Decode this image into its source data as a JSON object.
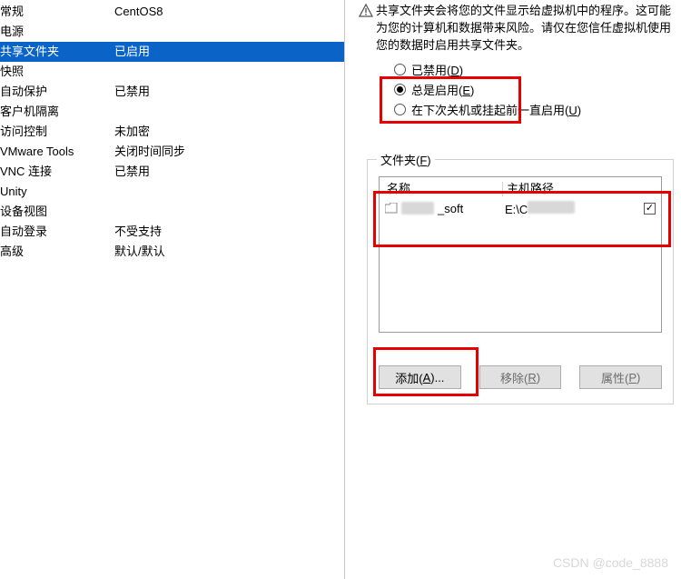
{
  "nav": {
    "items": [
      {
        "label": "常规",
        "value": "CentOS8",
        "selected": false
      },
      {
        "label": "电源",
        "value": "",
        "selected": false
      },
      {
        "label": "共享文件夹",
        "value": "已启用",
        "selected": true
      },
      {
        "label": "快照",
        "value": "",
        "selected": false
      },
      {
        "label": "自动保护",
        "value": "已禁用",
        "selected": false
      },
      {
        "label": "客户机隔离",
        "value": "",
        "selected": false
      },
      {
        "label": "访问控制",
        "value": "未加密",
        "selected": false
      },
      {
        "label": "VMware Tools",
        "value": "关闭时间同步",
        "selected": false
      },
      {
        "label": "VNC 连接",
        "value": "已禁用",
        "selected": false
      },
      {
        "label": "Unity",
        "value": "",
        "selected": false
      },
      {
        "label": "设备视图",
        "value": "",
        "selected": false
      },
      {
        "label": "自动登录",
        "value": "不受支持",
        "selected": false
      },
      {
        "label": "高级",
        "value": "默认/默认",
        "selected": false
      }
    ]
  },
  "info": {
    "text": "共享文件夹会将您的文件显示给虚拟机中的程序。这可能为您的计算机和数据带来风险。请仅在您信任虚拟机使用您的数据时启用共享文件夹。"
  },
  "radios": {
    "disabled": {
      "text": "已禁用(",
      "hot": "D",
      "tail": ")"
    },
    "always": {
      "text": "总是启用(",
      "hot": "E",
      "tail": ")"
    },
    "until": {
      "text": "在下次关机或挂起前一直启用(",
      "hot": "U",
      "tail": ")"
    }
  },
  "folders": {
    "legend": {
      "text": "文件夹(",
      "hot": "F",
      "tail": ")"
    },
    "columns": {
      "name": "名称",
      "path": "主机路径"
    },
    "row": {
      "name_prefix": "",
      "name_suffix": "_soft",
      "path_prefix": "E:\\C"
    }
  },
  "buttons": {
    "add": {
      "text": "添加(",
      "hot": "A",
      "tail": ")..."
    },
    "remove": {
      "text": "移除(",
      "hot": "R",
      "tail": ")"
    },
    "props": {
      "text": "属性(",
      "hot": "P",
      "tail": ")"
    }
  },
  "watermark": "CSDN @code_8888"
}
